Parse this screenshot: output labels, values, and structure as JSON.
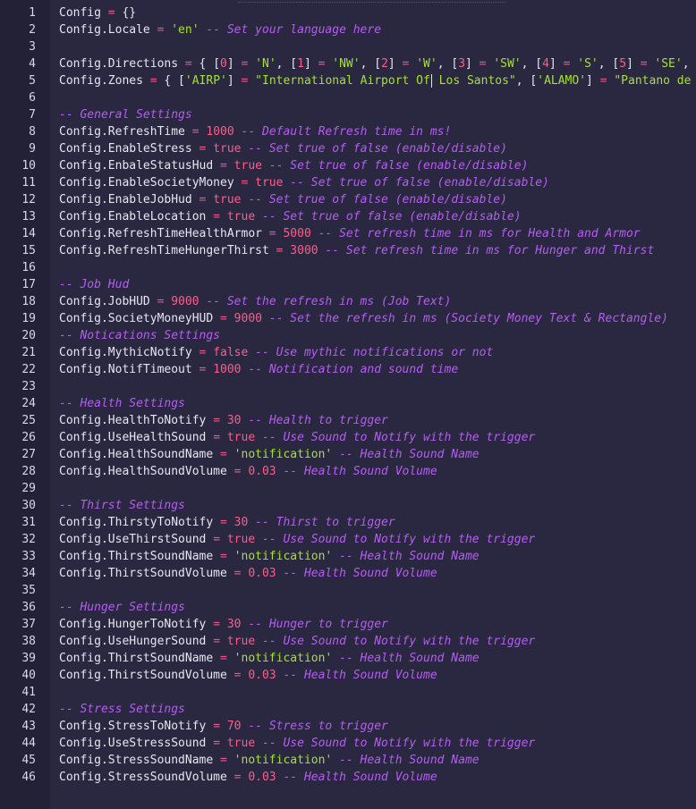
{
  "editor": {
    "language": "lua",
    "colors": {
      "background": "#2a2740",
      "gutter": "#232135",
      "plain": "#e6e6f0",
      "operator": "#f0568c",
      "number": "#ff5c8a",
      "string": "#a6e22e",
      "boolean": "#ff5c8a",
      "comment": "#b45ef0"
    },
    "lines": [
      {
        "n": "1",
        "tokens": [
          [
            "p",
            "Config"
          ],
          [
            "o",
            " = "
          ],
          [
            "p",
            "{}"
          ]
        ]
      },
      {
        "n": "2",
        "tokens": [
          [
            "p",
            "Config.Locale"
          ],
          [
            "o",
            " = "
          ],
          [
            "s",
            "'en'"
          ],
          [
            "c",
            " -- Set your language here"
          ]
        ]
      },
      {
        "n": "3",
        "tokens": []
      },
      {
        "n": "4",
        "tokens": [
          [
            "p",
            "Config.Directions"
          ],
          [
            "o",
            " = "
          ],
          [
            "p",
            "{ ["
          ],
          [
            "n",
            "0"
          ],
          [
            "p",
            "]"
          ],
          [
            "o",
            " = "
          ],
          [
            "s",
            "'N'"
          ],
          [
            "p",
            ", ["
          ],
          [
            "n",
            "1"
          ],
          [
            "p",
            "]"
          ],
          [
            "o",
            " = "
          ],
          [
            "s",
            "'NW'"
          ],
          [
            "p",
            ", ["
          ],
          [
            "n",
            "2"
          ],
          [
            "p",
            "]"
          ],
          [
            "o",
            " = "
          ],
          [
            "s",
            "'W'"
          ],
          [
            "p",
            ", ["
          ],
          [
            "n",
            "3"
          ],
          [
            "p",
            "]"
          ],
          [
            "o",
            " = "
          ],
          [
            "s",
            "'SW'"
          ],
          [
            "p",
            ", ["
          ],
          [
            "n",
            "4"
          ],
          [
            "p",
            "]"
          ],
          [
            "o",
            " = "
          ],
          [
            "s",
            "'S'"
          ],
          [
            "p",
            ", ["
          ],
          [
            "n",
            "5"
          ],
          [
            "p",
            "]"
          ],
          [
            "o",
            " = "
          ],
          [
            "s",
            "'SE'"
          ],
          [
            "p",
            ", ["
          ]
        ]
      },
      {
        "n": "5",
        "tokens": [
          [
            "p",
            "Config.Zones"
          ],
          [
            "o",
            " = "
          ],
          [
            "p",
            "{ ["
          ],
          [
            "s",
            "'AIRP'"
          ],
          [
            "p",
            "]"
          ],
          [
            "o",
            " = "
          ],
          [
            "s",
            "\"International Airport Of"
          ],
          [
            "cur",
            ""
          ],
          [
            "s",
            " Los Santos\""
          ],
          [
            "p",
            ", ["
          ],
          [
            "s",
            "'ALAMO'"
          ],
          [
            "p",
            "]"
          ],
          [
            "o",
            " = "
          ],
          [
            "s",
            "\"Pantano de al"
          ]
        ]
      },
      {
        "n": "6",
        "tokens": []
      },
      {
        "n": "7",
        "tokens": [
          [
            "c",
            "-- General Settings"
          ]
        ]
      },
      {
        "n": "8",
        "tokens": [
          [
            "p",
            "Config.RefreshTime"
          ],
          [
            "o",
            " = "
          ],
          [
            "n",
            "1000"
          ],
          [
            "c",
            " -- Default Refresh time in ms!"
          ]
        ]
      },
      {
        "n": "9",
        "tokens": [
          [
            "p",
            "Config.EnableStress"
          ],
          [
            "o",
            " = "
          ],
          [
            "b",
            "true"
          ],
          [
            "c",
            " -- Set true of false (enable/disable)"
          ]
        ]
      },
      {
        "n": "10",
        "tokens": [
          [
            "p",
            "Config.EnbaleStatusHud"
          ],
          [
            "o",
            " = "
          ],
          [
            "b",
            "true"
          ],
          [
            "c",
            " -- Set true of false (enable/disable)"
          ]
        ]
      },
      {
        "n": "11",
        "tokens": [
          [
            "p",
            "Config.EnableSocietyMoney"
          ],
          [
            "o",
            " = "
          ],
          [
            "b",
            "true"
          ],
          [
            "c",
            " -- Set true of false (enable/disable)"
          ]
        ]
      },
      {
        "n": "12",
        "tokens": [
          [
            "p",
            "Config.EnableJobHud"
          ],
          [
            "o",
            " = "
          ],
          [
            "b",
            "true"
          ],
          [
            "c",
            " -- Set true of false (enable/disable)"
          ]
        ]
      },
      {
        "n": "13",
        "tokens": [
          [
            "p",
            "Config.EnableLocation"
          ],
          [
            "o",
            " = "
          ],
          [
            "b",
            "true"
          ],
          [
            "c",
            " -- Set true of false (enable/disable)"
          ]
        ]
      },
      {
        "n": "14",
        "tokens": [
          [
            "p",
            "Config.RefreshTimeHealthArmor"
          ],
          [
            "o",
            " = "
          ],
          [
            "n",
            "5000"
          ],
          [
            "c",
            " -- Set refresh time in ms for Health and Armor"
          ]
        ]
      },
      {
        "n": "15",
        "tokens": [
          [
            "p",
            "Config.RefreshTimeHungerThirst"
          ],
          [
            "o",
            " = "
          ],
          [
            "n",
            "3000"
          ],
          [
            "c",
            " -- Set refresh time in ms for Hunger and Thirst"
          ]
        ]
      },
      {
        "n": "16",
        "tokens": []
      },
      {
        "n": "17",
        "tokens": [
          [
            "c",
            "-- Job Hud"
          ]
        ]
      },
      {
        "n": "18",
        "tokens": [
          [
            "p",
            "Config.JobHUD"
          ],
          [
            "o",
            " = "
          ],
          [
            "n",
            "9000"
          ],
          [
            "c",
            " -- Set the refresh in ms (Job Text)"
          ]
        ]
      },
      {
        "n": "19",
        "tokens": [
          [
            "p",
            "Config.SocietyMoneyHUD"
          ],
          [
            "o",
            " = "
          ],
          [
            "n",
            "9000"
          ],
          [
            "c",
            " -- Set the refresh in ms (Society Money Text & Rectangle)"
          ]
        ]
      },
      {
        "n": "20",
        "tokens": [
          [
            "c",
            "-- Notications Settings"
          ]
        ]
      },
      {
        "n": "21",
        "tokens": [
          [
            "p",
            "Config.MythicNotify"
          ],
          [
            "o",
            " = "
          ],
          [
            "b",
            "false"
          ],
          [
            "c",
            " -- Use mythic notifications or not"
          ]
        ]
      },
      {
        "n": "22",
        "tokens": [
          [
            "p",
            "Config.NotifTimeout"
          ],
          [
            "o",
            " = "
          ],
          [
            "n",
            "1000"
          ],
          [
            "c",
            " -- Notification and sound time"
          ]
        ]
      },
      {
        "n": "23",
        "tokens": []
      },
      {
        "n": "24",
        "tokens": [
          [
            "c",
            "-- Health Settings"
          ]
        ]
      },
      {
        "n": "25",
        "tokens": [
          [
            "p",
            "Config.HealthToNotify"
          ],
          [
            "o",
            " = "
          ],
          [
            "n",
            "30"
          ],
          [
            "c",
            " -- Health to trigger"
          ]
        ]
      },
      {
        "n": "26",
        "tokens": [
          [
            "p",
            "Config.UseHealthSound"
          ],
          [
            "o",
            " = "
          ],
          [
            "b",
            "true"
          ],
          [
            "c",
            " -- Use Sound to Notify with the trigger"
          ]
        ]
      },
      {
        "n": "27",
        "tokens": [
          [
            "p",
            "Config.HealthSoundName"
          ],
          [
            "o",
            " = "
          ],
          [
            "s",
            "'notification'"
          ],
          [
            "c",
            " -- Health Sound Name"
          ]
        ]
      },
      {
        "n": "28",
        "tokens": [
          [
            "p",
            "Config.HealthSoundVolume"
          ],
          [
            "o",
            " = "
          ],
          [
            "n",
            "0.03"
          ],
          [
            "c",
            " -- Health Sound Volume"
          ]
        ]
      },
      {
        "n": "29",
        "tokens": []
      },
      {
        "n": "30",
        "tokens": [
          [
            "c",
            "-- Thirst Settings"
          ]
        ]
      },
      {
        "n": "31",
        "tokens": [
          [
            "p",
            "Config.ThirstyToNotify"
          ],
          [
            "o",
            " = "
          ],
          [
            "n",
            "30"
          ],
          [
            "c",
            " -- Thirst to trigger"
          ]
        ]
      },
      {
        "n": "32",
        "tokens": [
          [
            "p",
            "Config.UseThirstSound"
          ],
          [
            "o",
            " = "
          ],
          [
            "b",
            "true"
          ],
          [
            "c",
            " -- Use Sound to Notify with the trigger"
          ]
        ]
      },
      {
        "n": "33",
        "tokens": [
          [
            "p",
            "Config.ThirstSoundName"
          ],
          [
            "o",
            " = "
          ],
          [
            "s",
            "'notification'"
          ],
          [
            "c",
            " -- Health Sound Name"
          ]
        ]
      },
      {
        "n": "34",
        "tokens": [
          [
            "p",
            "Config.ThirstSoundVolume"
          ],
          [
            "o",
            " = "
          ],
          [
            "n",
            "0.03"
          ],
          [
            "c",
            " -- Health Sound Volume"
          ]
        ]
      },
      {
        "n": "35",
        "tokens": []
      },
      {
        "n": "36",
        "tokens": [
          [
            "c",
            "-- Hunger Settings"
          ]
        ]
      },
      {
        "n": "37",
        "tokens": [
          [
            "p",
            "Config.HungerToNotify"
          ],
          [
            "o",
            " = "
          ],
          [
            "n",
            "30"
          ],
          [
            "c",
            " -- Hunger to trigger"
          ]
        ]
      },
      {
        "n": "38",
        "tokens": [
          [
            "p",
            "Config.UseHungerSound"
          ],
          [
            "o",
            " = "
          ],
          [
            "b",
            "true"
          ],
          [
            "c",
            " -- Use Sound to Notify with the trigger"
          ]
        ]
      },
      {
        "n": "39",
        "tokens": [
          [
            "p",
            "Config.ThirstSoundName"
          ],
          [
            "o",
            " = "
          ],
          [
            "s",
            "'notification'"
          ],
          [
            "c",
            " -- Health Sound Name"
          ]
        ]
      },
      {
        "n": "40",
        "tokens": [
          [
            "p",
            "Config.ThirstSoundVolume"
          ],
          [
            "o",
            " = "
          ],
          [
            "n",
            "0.03"
          ],
          [
            "c",
            " -- Health Sound Volume"
          ]
        ]
      },
      {
        "n": "41",
        "tokens": []
      },
      {
        "n": "42",
        "tokens": [
          [
            "c",
            "-- Stress Settings"
          ]
        ]
      },
      {
        "n": "43",
        "tokens": [
          [
            "p",
            "Config.StressToNotify"
          ],
          [
            "o",
            " = "
          ],
          [
            "n",
            "70"
          ],
          [
            "c",
            " -- Stress to trigger"
          ]
        ]
      },
      {
        "n": "44",
        "tokens": [
          [
            "p",
            "Config.UseStressSound"
          ],
          [
            "o",
            " = "
          ],
          [
            "b",
            "true"
          ],
          [
            "c",
            " -- Use Sound to Notify with the trigger"
          ]
        ]
      },
      {
        "n": "45",
        "tokens": [
          [
            "p",
            "Config.StressSoundName"
          ],
          [
            "o",
            " = "
          ],
          [
            "s",
            "'notification'"
          ],
          [
            "c",
            " -- Health Sound Name"
          ]
        ]
      },
      {
        "n": "46",
        "tokens": [
          [
            "p",
            "Config.StressSoundVolume"
          ],
          [
            "o",
            " = "
          ],
          [
            "n",
            "0.03"
          ],
          [
            "c",
            " -- Health Sound Volume"
          ]
        ]
      }
    ]
  }
}
